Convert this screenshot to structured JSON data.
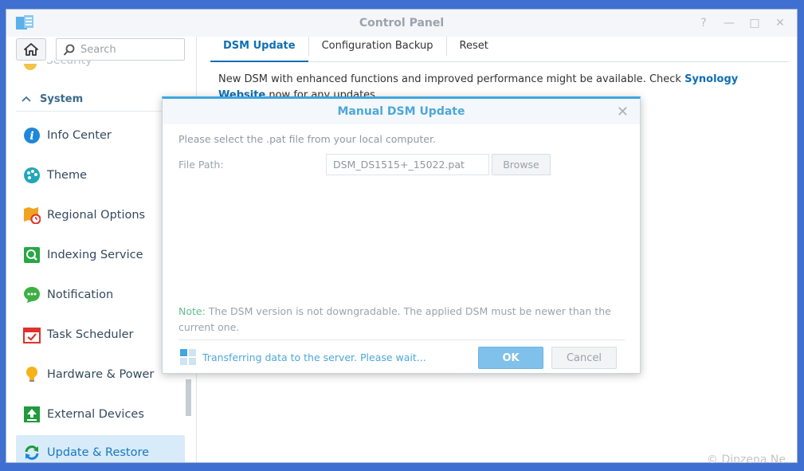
{
  "window": {
    "title": "Control Panel",
    "controls": [
      "?",
      "—",
      "□",
      "✕"
    ]
  },
  "sidebar": {
    "search_placeholder": "Search",
    "faded_item": "Security",
    "section": "System",
    "items": [
      {
        "label": "Info Center",
        "icon": "info-icon"
      },
      {
        "label": "Theme",
        "icon": "palette-icon"
      },
      {
        "label": "Regional Options",
        "icon": "map-clock-icon"
      },
      {
        "label": "Indexing Service",
        "icon": "magnifier-icon"
      },
      {
        "label": "Notification",
        "icon": "chat-bubble-icon"
      },
      {
        "label": "Task Scheduler",
        "icon": "calendar-check-icon"
      },
      {
        "label": "Hardware & Power",
        "icon": "lightbulb-icon"
      },
      {
        "label": "External Devices",
        "icon": "upload-box-icon"
      },
      {
        "label": "Update & Restore",
        "icon": "refresh-icon",
        "active": true
      }
    ]
  },
  "tabs": [
    "DSM Update",
    "Configuration Backup",
    "Reset"
  ],
  "main": {
    "message_start": "New DSM with enhanced functions and improved performance might be available. Check ",
    "message_link": "Synology Website",
    "message_end": " now for any updates."
  },
  "dialog": {
    "title": "Manual DSM Update",
    "intro": "Please select the .pat file from your local computer.",
    "file_path_label": "File Path:",
    "file_path_value": "DSM_DS1515+_15022.pat",
    "browse_label": "Browse",
    "note_label": "Note:",
    "note_text": " The DSM version is not downgradable. The applied DSM must be newer than the current one.",
    "progress_text": "Transferring data to the server. Please wait...",
    "ok_label": "OK",
    "cancel_label": "Cancel"
  },
  "watermark": "© Dinzena Ne",
  "colors": {
    "desktop": "#3f6fd0",
    "accent": "#0f6fb4",
    "dialog_accent": "#3fa6df",
    "ok_button": "#7fc1ea",
    "active_nav_bg": "#d7ebf9"
  }
}
